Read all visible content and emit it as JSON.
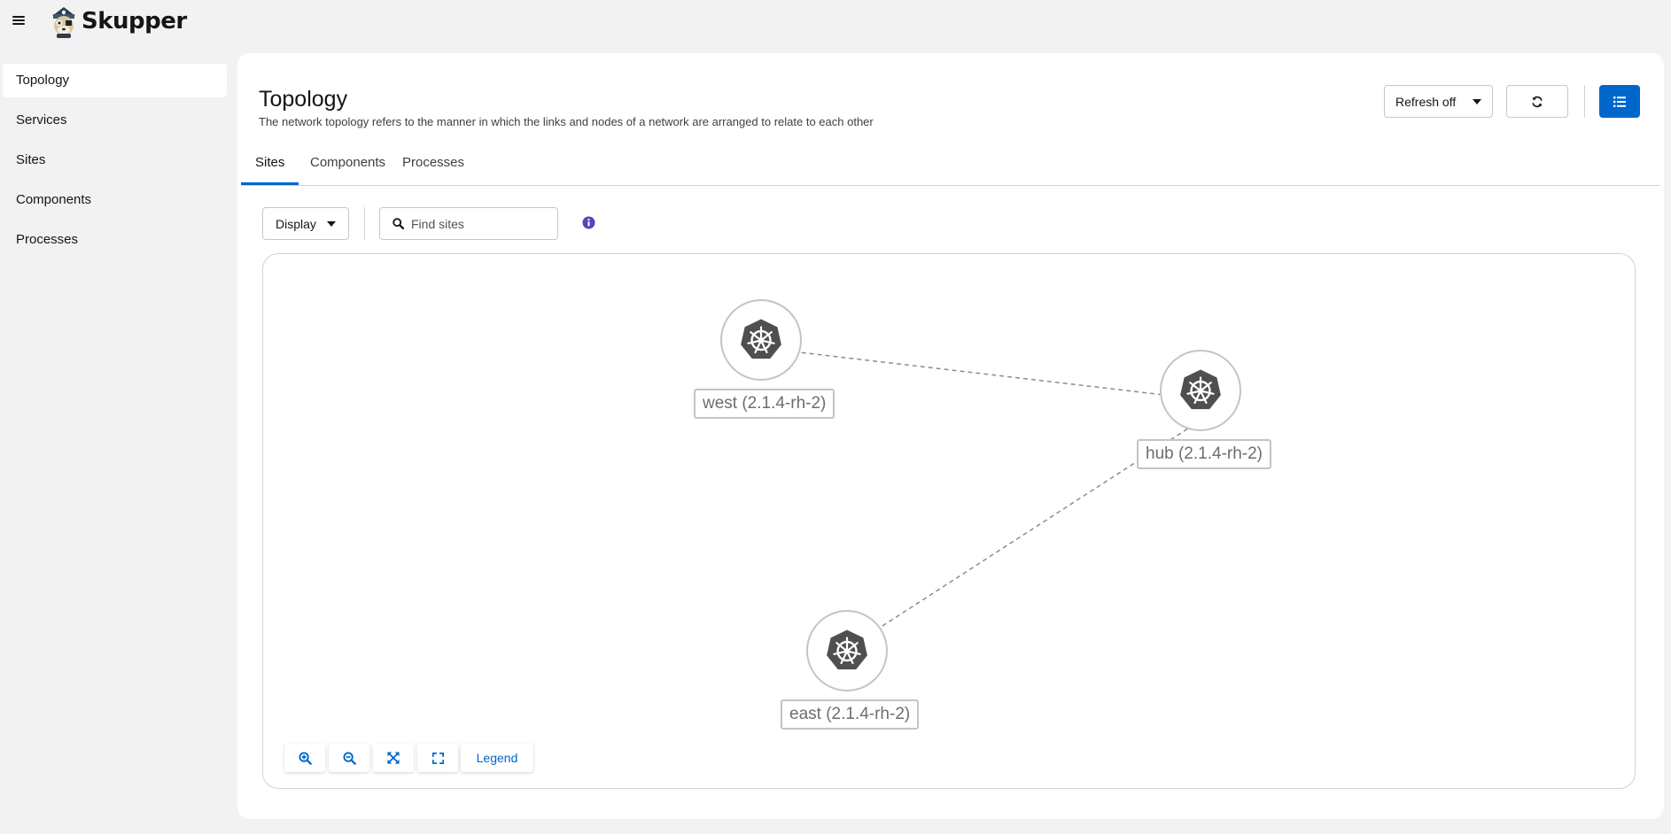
{
  "app": {
    "name": "Skupper"
  },
  "sidebar": {
    "items": [
      {
        "label": "Topology",
        "active": true
      },
      {
        "label": "Services",
        "active": false
      },
      {
        "label": "Sites",
        "active": false
      },
      {
        "label": "Components",
        "active": false
      },
      {
        "label": "Processes",
        "active": false
      }
    ]
  },
  "header": {
    "title": "Topology",
    "description": "The network topology refers to the manner in which the links and nodes of a network are arranged to relate to each other",
    "refresh_label": "Refresh off"
  },
  "tabs": [
    {
      "label": "Sites",
      "active": true
    },
    {
      "label": "Components",
      "active": false
    },
    {
      "label": "Processes",
      "active": false
    }
  ],
  "toolbar": {
    "display_label": "Display",
    "search_placeholder": "Find sites"
  },
  "graph": {
    "nodes": [
      {
        "id": "west",
        "label": "west (2.1.4-rh-2)",
        "icon": "kubernetes-icon"
      },
      {
        "id": "hub",
        "label": "hub (2.1.4-rh-2)",
        "icon": "kubernetes-icon"
      },
      {
        "id": "east",
        "label": "east (2.1.4-rh-2)",
        "icon": "kubernetes-icon"
      }
    ],
    "links": [
      {
        "from": "west",
        "to": "hub",
        "style": "dashed"
      },
      {
        "from": "east",
        "to": "hub",
        "style": "dashed"
      }
    ],
    "controls": {
      "legend_label": "Legend"
    }
  },
  "colors": {
    "accent": "#0066cc",
    "info": "#5e40be",
    "node_icon": "#4f4f4f",
    "page_bg": "#f2f2f2"
  }
}
